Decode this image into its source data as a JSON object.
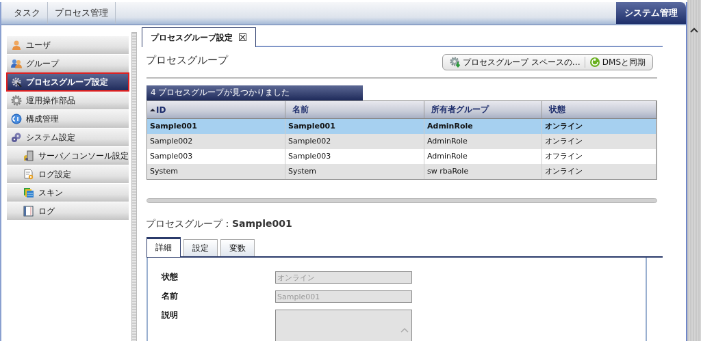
{
  "top_tabs": [
    {
      "label": "タスク",
      "selected": false
    },
    {
      "label": "プロセス管理",
      "selected": false
    },
    {
      "label": "システム管理",
      "selected": true
    }
  ],
  "sidebar": {
    "items": [
      {
        "label": "ユーザ",
        "selected": false
      },
      {
        "label": "グループ",
        "selected": false
      },
      {
        "label": "プロセスグループ設定",
        "selected": true
      },
      {
        "label": "運用操作部品",
        "selected": false
      },
      {
        "label": "構成管理",
        "selected": false
      },
      {
        "label": "システム設定",
        "selected": false,
        "children": [
          {
            "label": "サーバ／コンソール設定",
            "selected": false
          },
          {
            "label": "ログ設定",
            "selected": false
          },
          {
            "label": "スキン",
            "selected": false
          },
          {
            "label": "ログ",
            "selected": false
          }
        ]
      }
    ]
  },
  "content_tab": {
    "label": "プロセスグループ設定",
    "close": "☒"
  },
  "page_title": "プロセスグループ",
  "toolbar": [
    "プロセスグループ スペースの…",
    "DMSと同期"
  ],
  "table": {
    "caption": "4 プロセスグループが見つかりました",
    "columns": [
      {
        "label": "ID",
        "sorted": true
      },
      {
        "label": "名前",
        "sorted": false
      },
      {
        "label": "所有者グループ",
        "sorted": false
      },
      {
        "label": "状態",
        "sorted": false
      }
    ],
    "rows": [
      {
        "selected": true,
        "cells": [
          "Sample001",
          "Sample001",
          "AdminRole",
          "オンライン"
        ]
      },
      {
        "selected": false,
        "cells": [
          "Sample002",
          "Sample002",
          "AdminRole",
          "オンライン"
        ]
      },
      {
        "selected": false,
        "cells": [
          "Sample003",
          "Sample003",
          "AdminRole",
          "オフライン"
        ]
      },
      {
        "selected": false,
        "cells": [
          "System",
          "System",
          "sw rbaRole",
          "オンライン"
        ]
      }
    ]
  },
  "detail": {
    "title": "プロセスグループ：**Sample001**",
    "tabs": [
      {
        "label": "詳細",
        "selected": true
      },
      {
        "label": "設定",
        "selected": false
      },
      {
        "label": "変数",
        "selected": false
      }
    ],
    "fields": [
      {
        "label": "状態",
        "kind": "input",
        "value": "オンライン"
      },
      {
        "label": "名前",
        "kind": "input",
        "value": "Sample001"
      },
      {
        "label": "説明",
        "kind": "textarea"
      }
    ]
  }
}
